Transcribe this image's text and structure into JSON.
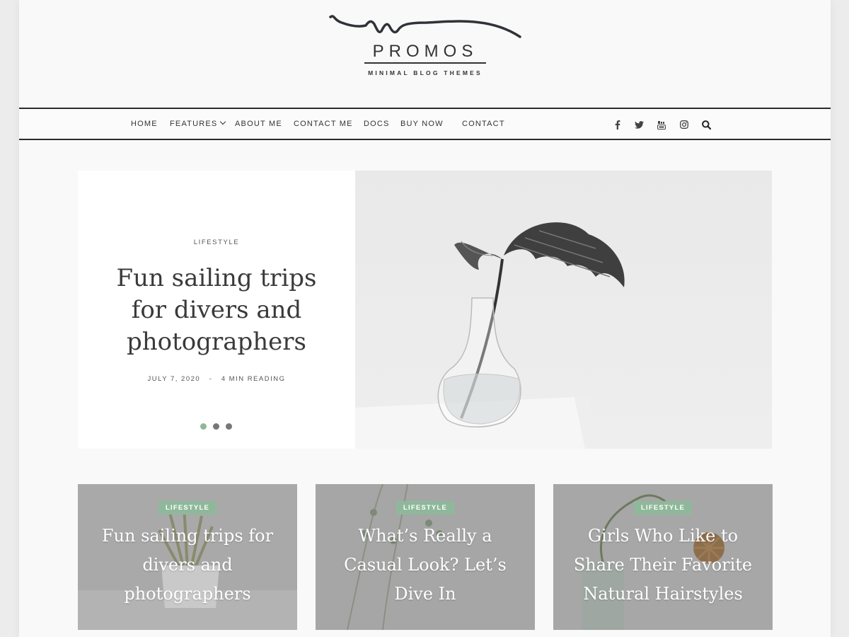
{
  "brand": {
    "name": "PROMOS",
    "tagline": "MINIMAL BLOG THEMES"
  },
  "nav": {
    "items": [
      {
        "label": "HOME"
      },
      {
        "label": "FEATURES"
      },
      {
        "label": "ABOUT ME"
      },
      {
        "label": "CONTACT ME"
      },
      {
        "label": "DOCS"
      },
      {
        "label": "BUY NOW"
      },
      {
        "label": "CONTACT"
      }
    ],
    "social_icons": [
      "facebook-icon",
      "twitter-icon",
      "youtube-icon",
      "instagram-icon",
      "search-icon"
    ]
  },
  "hero": {
    "category": "LIFESTYLE",
    "title": "Fun sailing trips for divers and photographers",
    "date": "JULY 7, 2020",
    "separator": "-",
    "reading": "4 MIN READING",
    "slides": 3,
    "active_slide": 1
  },
  "cards": [
    {
      "category": "LIFESTYLE",
      "title": "Fun sailing trips for divers and photographers"
    },
    {
      "category": "LIFESTYLE",
      "title": "What’s Really a Casual Look? Let’s Dive In"
    },
    {
      "category": "LIFESTYLE",
      "title": "Girls Who Like to Share Their Favorite Natural Hairstyles"
    }
  ],
  "colors": {
    "accent": "#8fb89b",
    "text": "#333333",
    "page_bg": "#f9f9f9"
  }
}
